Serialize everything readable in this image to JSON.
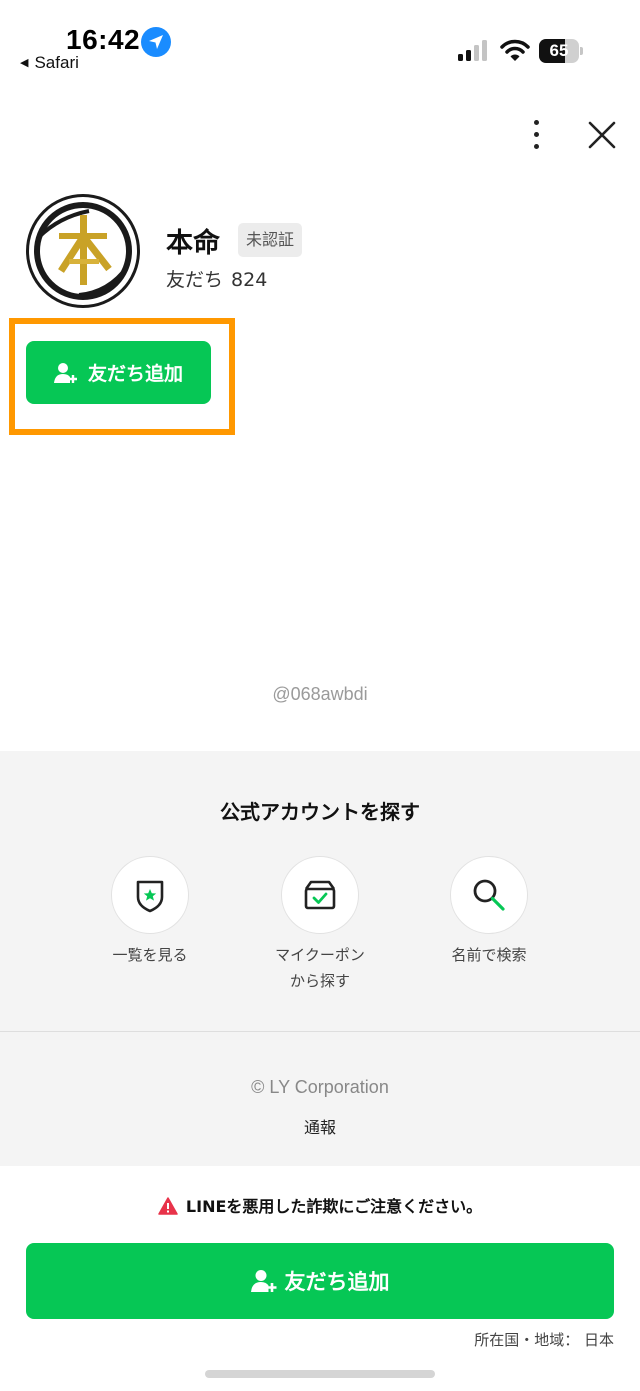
{
  "status_bar": {
    "time": "16:42",
    "back_app": "Safari",
    "battery": "65",
    "battery_level": 0.65
  },
  "header": {
    "more_icon": "more-vertical-icon",
    "close_icon": "close-icon"
  },
  "profile": {
    "name": "本命",
    "badge": "未認証",
    "friends_label": "友だち",
    "friends_count": "824",
    "add_friend_label": "友だち追加",
    "account_id": "@068awbdi"
  },
  "explore": {
    "title": "公式アカウントを探す",
    "items": [
      {
        "label": "一覧を見る",
        "icon": "shield-star-icon"
      },
      {
        "label": "マイクーポン\nから探す",
        "icon": "coupon-box-icon"
      },
      {
        "label": "名前で検索",
        "icon": "search-icon"
      }
    ]
  },
  "footer": {
    "copyright": "© LY Corporation",
    "report": "通報"
  },
  "bottom": {
    "warning": "LINEを悪用した詐欺にご注意ください。",
    "add_friend_label": "友だち追加",
    "region": "所在国・地域： 日本"
  },
  "colors": {
    "line_green": "#06c755",
    "highlight_orange": "#ff9800",
    "warning_red": "#e8334a"
  }
}
